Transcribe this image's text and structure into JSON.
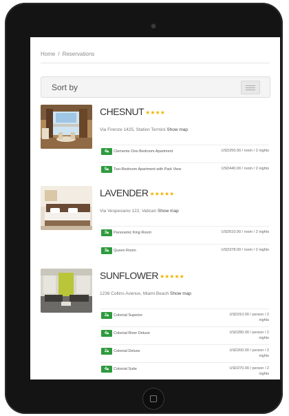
{
  "breadcrumb": [
    "Home",
    "/",
    "Reservations"
  ],
  "sort": {
    "label": "Sort by"
  },
  "hotels": [
    {
      "name": "CHESNUT",
      "stars": "★★★★",
      "address": "Via Firenze 1425, Station Termini",
      "map_label": "Show map",
      "rooms": [
        {
          "badge": "4",
          "name": "Clemente One-Bedroom Apartment",
          "price": "USD250.00 / room / 2 nights"
        },
        {
          "badge": "5",
          "name": "Two-Bedroom Apartment with Park View",
          "price": "USD440.00 / room / 2 nights"
        }
      ]
    },
    {
      "name": "LAVENDER",
      "stars": "★★★★★",
      "address": "Via Vespesiano 122, Vatican",
      "map_label": "Show map",
      "rooms": [
        {
          "badge": "3",
          "name": "Panoramic King Room",
          "price": "USD510.00 / room / 2 nights"
        },
        {
          "badge": "3",
          "name": "Queen Room",
          "price": "USD378.00 / room / 2 nights"
        }
      ]
    },
    {
      "name": "SUNFLOWER",
      "stars": "★★★★★",
      "address": "1236 Collins Avenue, Miami Beach",
      "map_label": "Show map",
      "rooms": [
        {
          "badge": "2",
          "name": "Colonial Superior",
          "price": "USD310.00 / person / 2 nights"
        },
        {
          "badge": "4",
          "name": "Colonial River Deluxe",
          "price": "USD280.00 / person / 2 nights"
        },
        {
          "badge": "2",
          "name": "Colonial Deluxe",
          "price": "USD200.00 / person / 2 nights"
        },
        {
          "badge": "4",
          "name": "Colonial Suite",
          "price": "USD270.00 / person / 2 nights"
        }
      ]
    }
  ]
}
